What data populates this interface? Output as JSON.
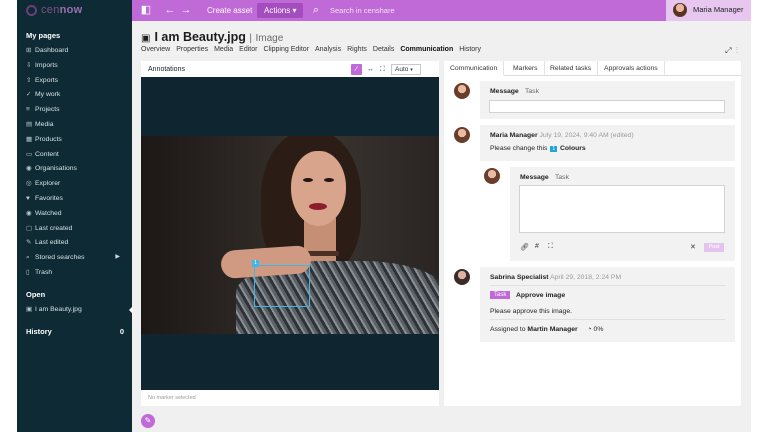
{
  "topbar": {
    "logo_prefix": "cen",
    "logo_suffix": "now",
    "create_asset": "Create asset",
    "actions": "Actions",
    "search_placeholder": "Search in censhare",
    "user_name": "Maria Manager",
    "colors": {
      "accent": "#c06ad8",
      "sidebar": "#0d2a35"
    }
  },
  "sidebar": {
    "my_pages_heading": "My pages",
    "items": [
      {
        "icon": "dashboard-icon",
        "label": "Dashboard"
      },
      {
        "icon": "imports-icon",
        "label": "Imports"
      },
      {
        "icon": "exports-icon",
        "label": "Exports"
      },
      {
        "icon": "my-work-icon",
        "label": "My work"
      },
      {
        "icon": "projects-icon",
        "label": "Projects"
      },
      {
        "icon": "media-icon",
        "label": "Media"
      },
      {
        "icon": "products-icon",
        "label": "Products"
      },
      {
        "icon": "content-icon",
        "label": "Content"
      },
      {
        "icon": "organisations-icon",
        "label": "Organisations"
      },
      {
        "icon": "explorer-icon",
        "label": "Explorer"
      },
      {
        "icon": "favorites-icon",
        "label": "Favorites"
      },
      {
        "icon": "watched-icon",
        "label": "Watched"
      },
      {
        "icon": "last-created-icon",
        "label": "Last created"
      },
      {
        "icon": "last-edited-icon",
        "label": "Last edited"
      },
      {
        "icon": "stored-searches-icon",
        "label": "Stored searches"
      },
      {
        "icon": "trash-icon",
        "label": "Trash"
      }
    ],
    "open_heading": "Open",
    "open_item": "I am Beauty.jpg",
    "history_heading": "History",
    "history_count": "0"
  },
  "asset": {
    "title": "I am Beauty.jpg",
    "separator": "|",
    "type": "Image",
    "tabs": [
      "Overview",
      "Properties",
      "Media",
      "Editor",
      "Clipping Editor",
      "Analysis",
      "Rights",
      "Details",
      "Communication",
      "History"
    ],
    "active_tab": "Communication"
  },
  "annotations": {
    "title": "Annotations",
    "zoom": "Auto",
    "marker_number": "1",
    "status": "No marker selected"
  },
  "communication": {
    "tabs": [
      "Communication",
      "Markers",
      "Related tasks",
      "Approvals actions"
    ],
    "composer": {
      "message_tab": "Message",
      "task_tab": "Task"
    },
    "comment1": {
      "author": "Maria Manager",
      "time": "July 19, 2024, 9:40 AM (edited)",
      "text_before": "Please change this",
      "marker": "1",
      "marker_label": "Colours"
    },
    "reply": {
      "message_tab": "Message",
      "task_tab": "Task",
      "post": "Post"
    },
    "comment2": {
      "author": "Sabrina Specialist",
      "time": "April 29, 2018, 2:24 PM",
      "badge": "Task",
      "task_title": "Approve image",
      "text": "Please approve this image.",
      "assigned_label": "Assigned to",
      "assignee": "Martin Manager",
      "progress": "0%"
    }
  }
}
